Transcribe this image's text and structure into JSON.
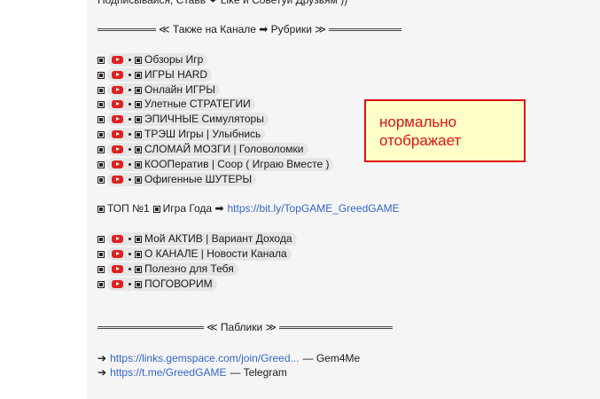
{
  "cut_top_text": "Подписывайся, Ставь ❤ Like и Советуй Друзьям ))",
  "separator_1": "≪ Также на Канале ➡ Рубрики ≫",
  "rubrics": [
    "Обзоры Игр",
    "ИГРЫ HARD",
    "Онлайн ИГРЫ",
    "Улетные СТРАТЕГИИ",
    "ЭПИЧНЫЕ Симуляторы",
    "ТРЭШ Игры | Улыбнись",
    "СЛОМАЙ МОЗГИ | Головоломки",
    "КООПератив | Coop ( Играю Вместе )",
    "Офигенные ШУТЕРЫ"
  ],
  "top_line": {
    "prefix": "ТОП №1",
    "middle": "Игра Года ➡",
    "link": "https://bit.ly/TopGAME_GreedGAME"
  },
  "extra_items": [
    "Мой АКТИВ | Вариант Дохода",
    "О КАНАЛЕ | Новости Канала",
    "Полезно для Тебя",
    "ПОГОВОРИМ"
  ],
  "separator_2": "≪ Паблики ≫",
  "publics": [
    {
      "arrow": "➔",
      "link": "https://links.gemspace.com/join/Greed...",
      "suffix": "— Gem4Me"
    },
    {
      "arrow": "➔",
      "link": "https://t.me/GreedGAME",
      "suffix": "— Telegram"
    }
  ],
  "note": {
    "line1": "нормально",
    "line2": "отображает"
  },
  "colors": {
    "youtube_red": "#e02020",
    "link_blue": "#3366cc",
    "note_red": "#dd1111",
    "note_bg": "#ffffc8"
  }
}
